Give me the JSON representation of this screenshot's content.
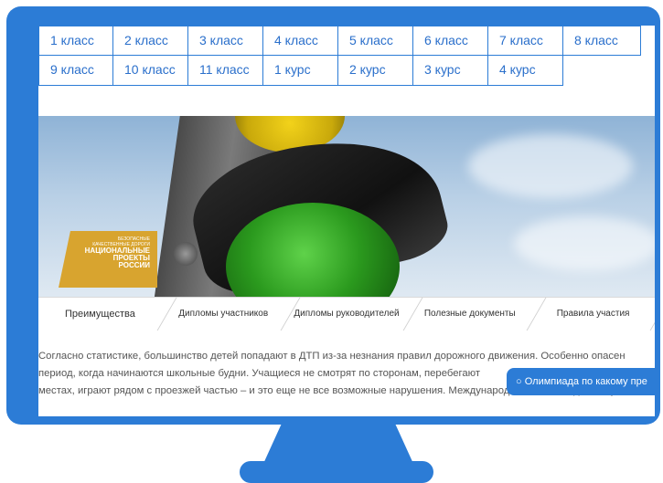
{
  "grades": {
    "row1": [
      "1 класс",
      "2 класс",
      "3 класс",
      "4 класс",
      "5 класс",
      "6 класс",
      "7 класс",
      "8 класс"
    ],
    "row2": [
      "9 класс",
      "10 класс",
      "11 класс",
      "1 курс",
      "2 курс",
      "3 курс",
      "4 курс"
    ]
  },
  "banner": {
    "logo_line1": "БЕЗОПАСНЫЕ",
    "logo_line2": "КАЧЕСТВЕННЫЕ ДОРОГИ",
    "logo_line3": "НАЦИОНАЛЬНЫЕ",
    "logo_line4": "ПРОЕКТЫ",
    "logo_line5": "РОССИИ"
  },
  "tabs": [
    "Преимущества",
    "Дипломы участников",
    "Дипломы руководителей",
    "Полезные документы",
    "Правила участия"
  ],
  "article": {
    "line1": "Согласно статистике, большинство детей попадают в ДТП из-за незнания правил дорожного движения. Особенно опасен",
    "line2": "период, когда начинаются школьные будни. Учащиеся не смотрят по сторонам, перебегают",
    "line3": "местах, играют рядом с проезжей частью – и это еще не все возможные нарушения. Международная Олимпиада Глобус"
  },
  "chip": {
    "icon": "circle-icon",
    "label": "Олимпиада по какому пре"
  },
  "colors": {
    "accent": "#2c7cd6",
    "link": "#2a6fcb"
  }
}
